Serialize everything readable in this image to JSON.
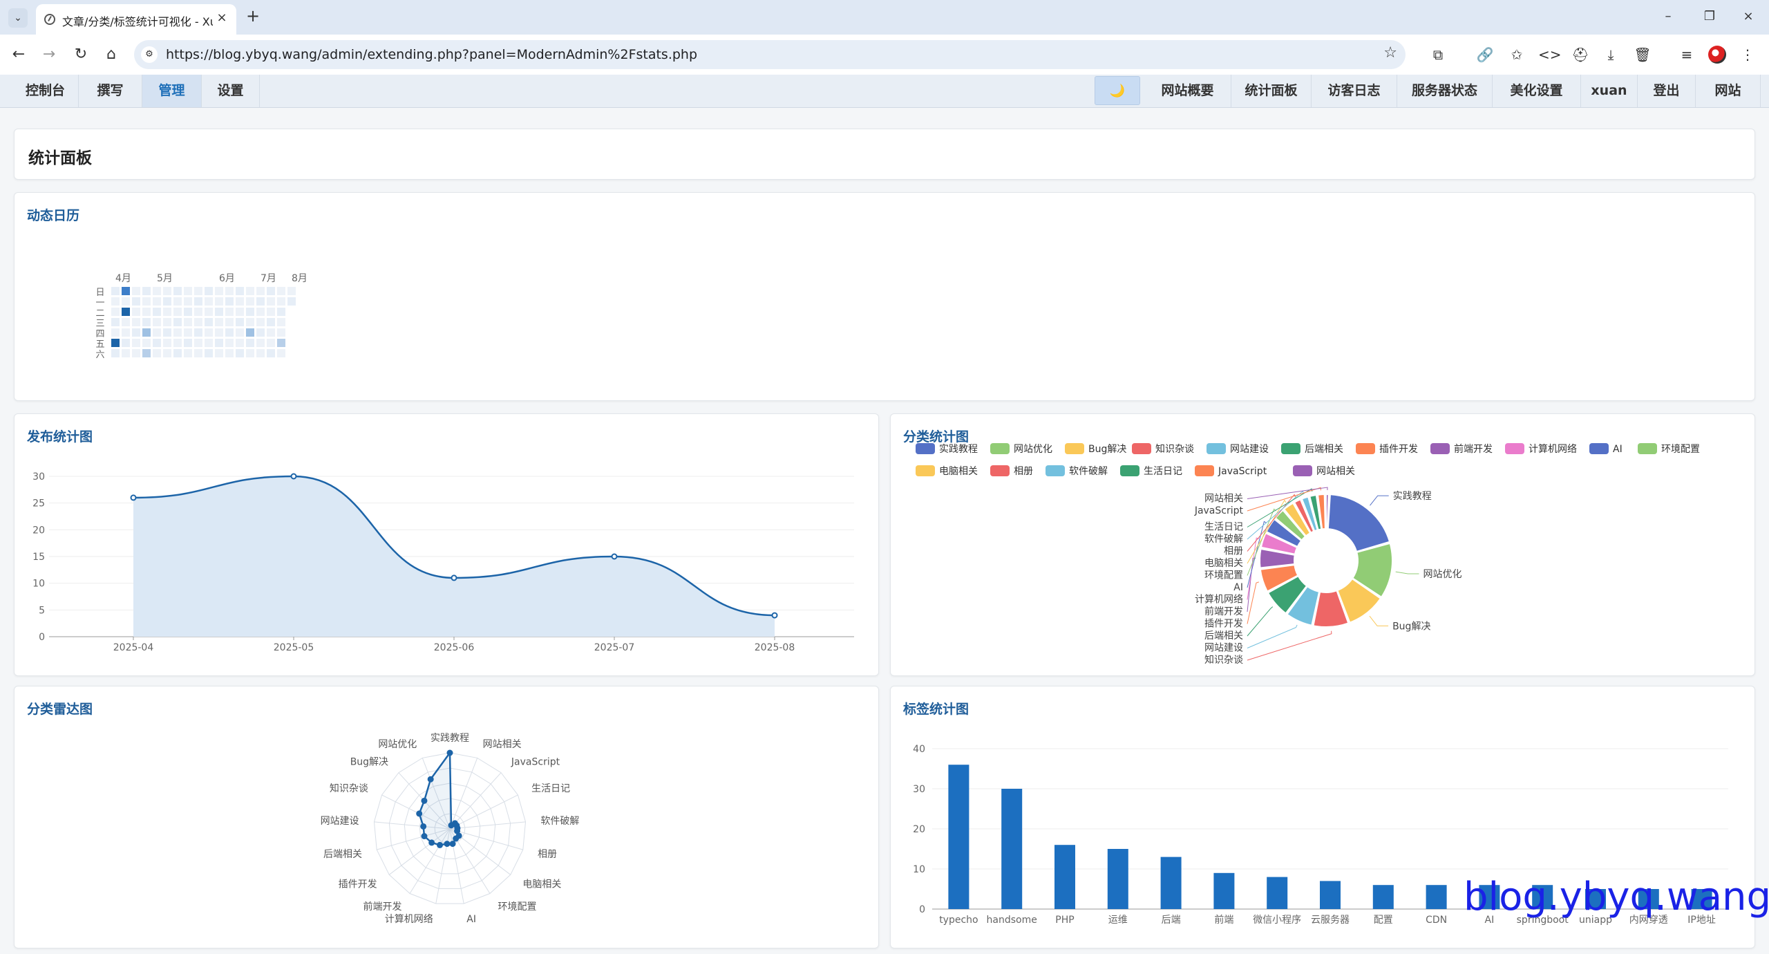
{
  "browser": {
    "tab_title": "文章/分类/标签统计可视化 - Xuan",
    "tab_list_icon": "chevron-down-icon",
    "url": "https://blog.ybyq.wang/admin/extending.php?panel=ModernAdmin%2Fstats.php"
  },
  "nav": {
    "left": [
      "控制台",
      "撰写",
      "管理",
      "设置"
    ],
    "active": "管理",
    "moon_icon": "🌙",
    "right": [
      "网站概要",
      "统计面板",
      "访客日志",
      "服务器状态",
      "美化设置",
      "xuan",
      "登出",
      "网站"
    ]
  },
  "page": {
    "title": "统计面板"
  },
  "calendar": {
    "title": "动态日历",
    "months": [
      "4月",
      "5月",
      "6月",
      "7月",
      "8月"
    ],
    "weekdays": [
      "日",
      "一",
      "二",
      "三",
      "四",
      "五",
      "六"
    ]
  },
  "publish_chart": {
    "title": "发布统计图",
    "chart_data": {
      "type": "area",
      "x": [
        "2025-04",
        "2025-05",
        "2025-06",
        "2025-07",
        "2025-08"
      ],
      "values": [
        26,
        30,
        11,
        15,
        4
      ],
      "ylim": [
        0,
        30
      ],
      "yticks": [
        0,
        5,
        10,
        15,
        20,
        25,
        30
      ],
      "color": "#1c64a8",
      "fill": "#dbe8f5"
    }
  },
  "category_pie": {
    "title": "分类统计图",
    "chart_data": {
      "type": "pie",
      "categories": [
        "实践教程",
        "网站优化",
        "Bug解决",
        "知识杂谈",
        "网站建设",
        "后端相关",
        "插件开发",
        "前端开发",
        "计算机网络",
        "AI",
        "环境配置",
        "电脑相关",
        "相册",
        "软件破解",
        "生活日记",
        "JavaScript",
        "网站相关"
      ],
      "values": [
        20,
        14,
        10,
        9,
        7,
        7,
        6,
        5,
        4,
        4,
        3,
        3,
        2,
        2,
        2,
        2,
        1
      ],
      "colors": [
        "#5470c6",
        "#91cc75",
        "#fac858",
        "#ee6666",
        "#73c0de",
        "#3ba272",
        "#fc8452",
        "#9a60b4",
        "#ea7ccc",
        "#5470c6",
        "#91cc75",
        "#fac858",
        "#ee6666",
        "#73c0de",
        "#3ba272",
        "#fc8452",
        "#9a60b4"
      ],
      "legend": "top"
    }
  },
  "radar_chart": {
    "title": "分类雷达图",
    "chart_data": {
      "type": "radar",
      "categories": [
        "实践教程",
        "网站相关",
        "JavaScript",
        "生活日记",
        "软件破解",
        "相册",
        "电脑相关",
        "环境配置",
        "AI",
        "计算机网络",
        "前端开发",
        "插件开发",
        "后端相关",
        "网站建设",
        "知识杂谈",
        "Bug解决",
        "网站优化"
      ],
      "values": [
        20,
        1,
        2,
        2,
        2,
        2,
        3,
        3,
        4,
        4,
        5,
        6,
        7,
        7,
        9,
        10,
        14
      ],
      "max": 20,
      "color": "#1c64a8"
    }
  },
  "tag_chart": {
    "title": "标签统计图",
    "chart_data": {
      "type": "bar",
      "categories": [
        "typecho",
        "handsome",
        "PHP",
        "运维",
        "后端",
        "前端",
        "微信小程序",
        "云服务器",
        "配置",
        "CDN",
        "AI",
        "springboot",
        "uniapp",
        "内网穿透",
        "IP地址"
      ],
      "values": [
        36,
        30,
        16,
        15,
        13,
        9,
        8,
        7,
        6,
        6,
        6,
        6,
        5,
        5,
        5
      ],
      "ylim": [
        0,
        40
      ],
      "yticks": [
        0,
        10,
        20,
        30,
        40
      ],
      "color": "#1c6fc0"
    }
  },
  "watermark": "blog.ybyq.wang"
}
